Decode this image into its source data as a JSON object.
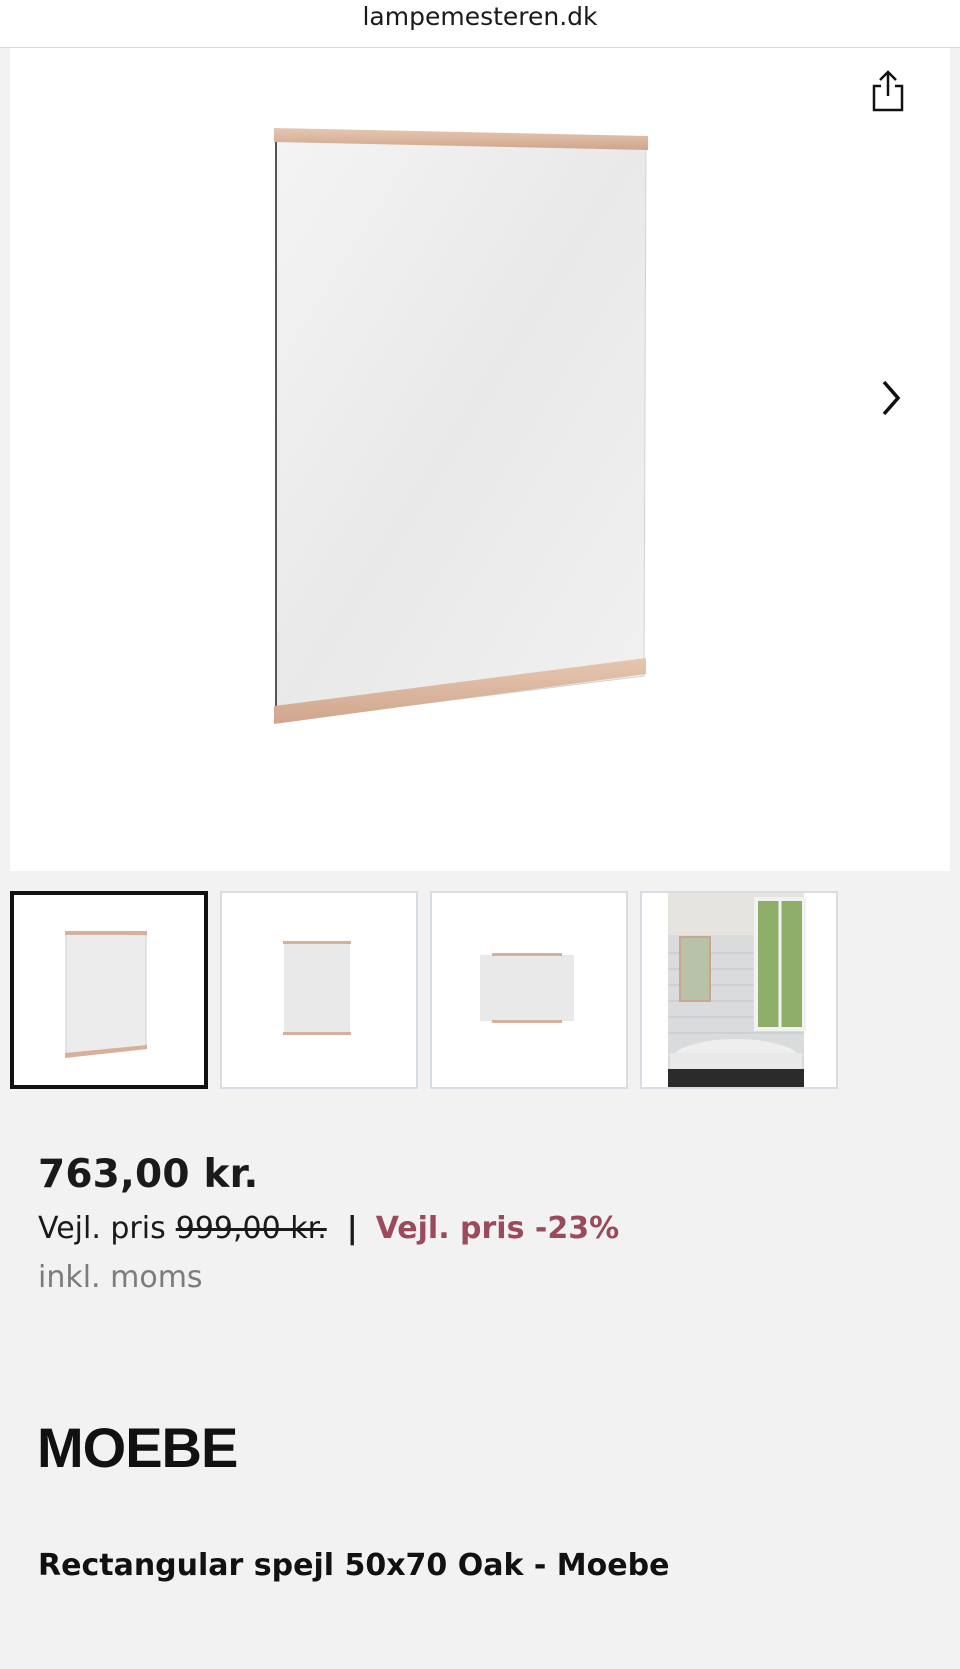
{
  "browser": {
    "url": "lampemesteren.dk"
  },
  "gallery": {
    "share_icon": "share-icon",
    "next_icon": "chevron-right-icon",
    "thumbnails": [
      {
        "name": "thumbnail-mirror-front",
        "active": true
      },
      {
        "name": "thumbnail-mirror-portrait",
        "active": false
      },
      {
        "name": "thumbnail-mirror-landscape",
        "active": false
      },
      {
        "name": "thumbnail-bathroom-scene",
        "active": false
      }
    ]
  },
  "pricing": {
    "price": "763,00 kr.",
    "rrp_label": "Vejl. pris",
    "rrp_old": "999,00 kr.",
    "separator": "|",
    "discount_label": "Vejl. pris -23%",
    "vat_note": "inkl. moms"
  },
  "brand": {
    "logo_text": "MOEBE"
  },
  "product": {
    "title": "Rectangular spejl 50x70 Oak - Moebe"
  },
  "colors": {
    "discount": "#9a4a5a",
    "oak": "#d9b59e",
    "active_border": "#111111"
  }
}
